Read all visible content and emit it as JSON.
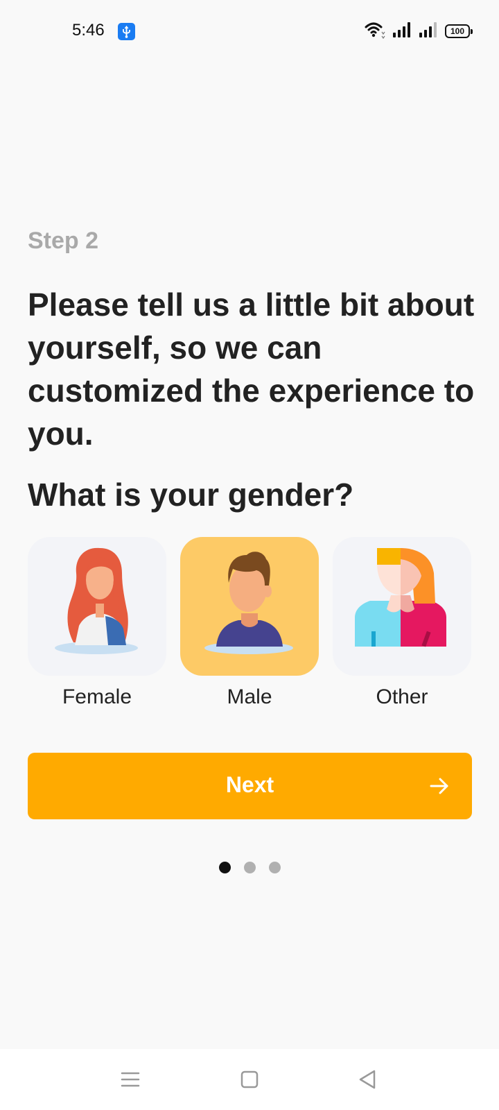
{
  "status_bar": {
    "time": "5:46",
    "usb_icon": "usb-debug-icon",
    "wifi_icon": "wifi-icon",
    "signal_icons": [
      "signal-icon",
      "signal-icon"
    ],
    "battery_level": "100"
  },
  "step_label": "Step 2",
  "headline": "Please tell us a little bit about yourself, so we can customized the experience to you.",
  "question": "What is your gender?",
  "options": [
    {
      "label": "Female",
      "icon": "female-avatar-icon",
      "selected": false
    },
    {
      "label": "Male",
      "icon": "male-avatar-icon",
      "selected": true
    },
    {
      "label": "Other",
      "icon": "other-avatar-icon",
      "selected": false
    }
  ],
  "next_button": {
    "label": "Next",
    "icon": "arrow-right-icon"
  },
  "pager": {
    "count": 3,
    "active": 0
  },
  "nav_bar": {
    "icons": [
      "menu-icon",
      "home-icon",
      "back-icon"
    ]
  },
  "colors": {
    "accent": "#ffaa00",
    "selected_card": "#fdca66",
    "card": "#f3f4f8",
    "background": "#f9f9f9",
    "dot_active": "#111111",
    "dot_inactive": "#b0b0b0"
  }
}
